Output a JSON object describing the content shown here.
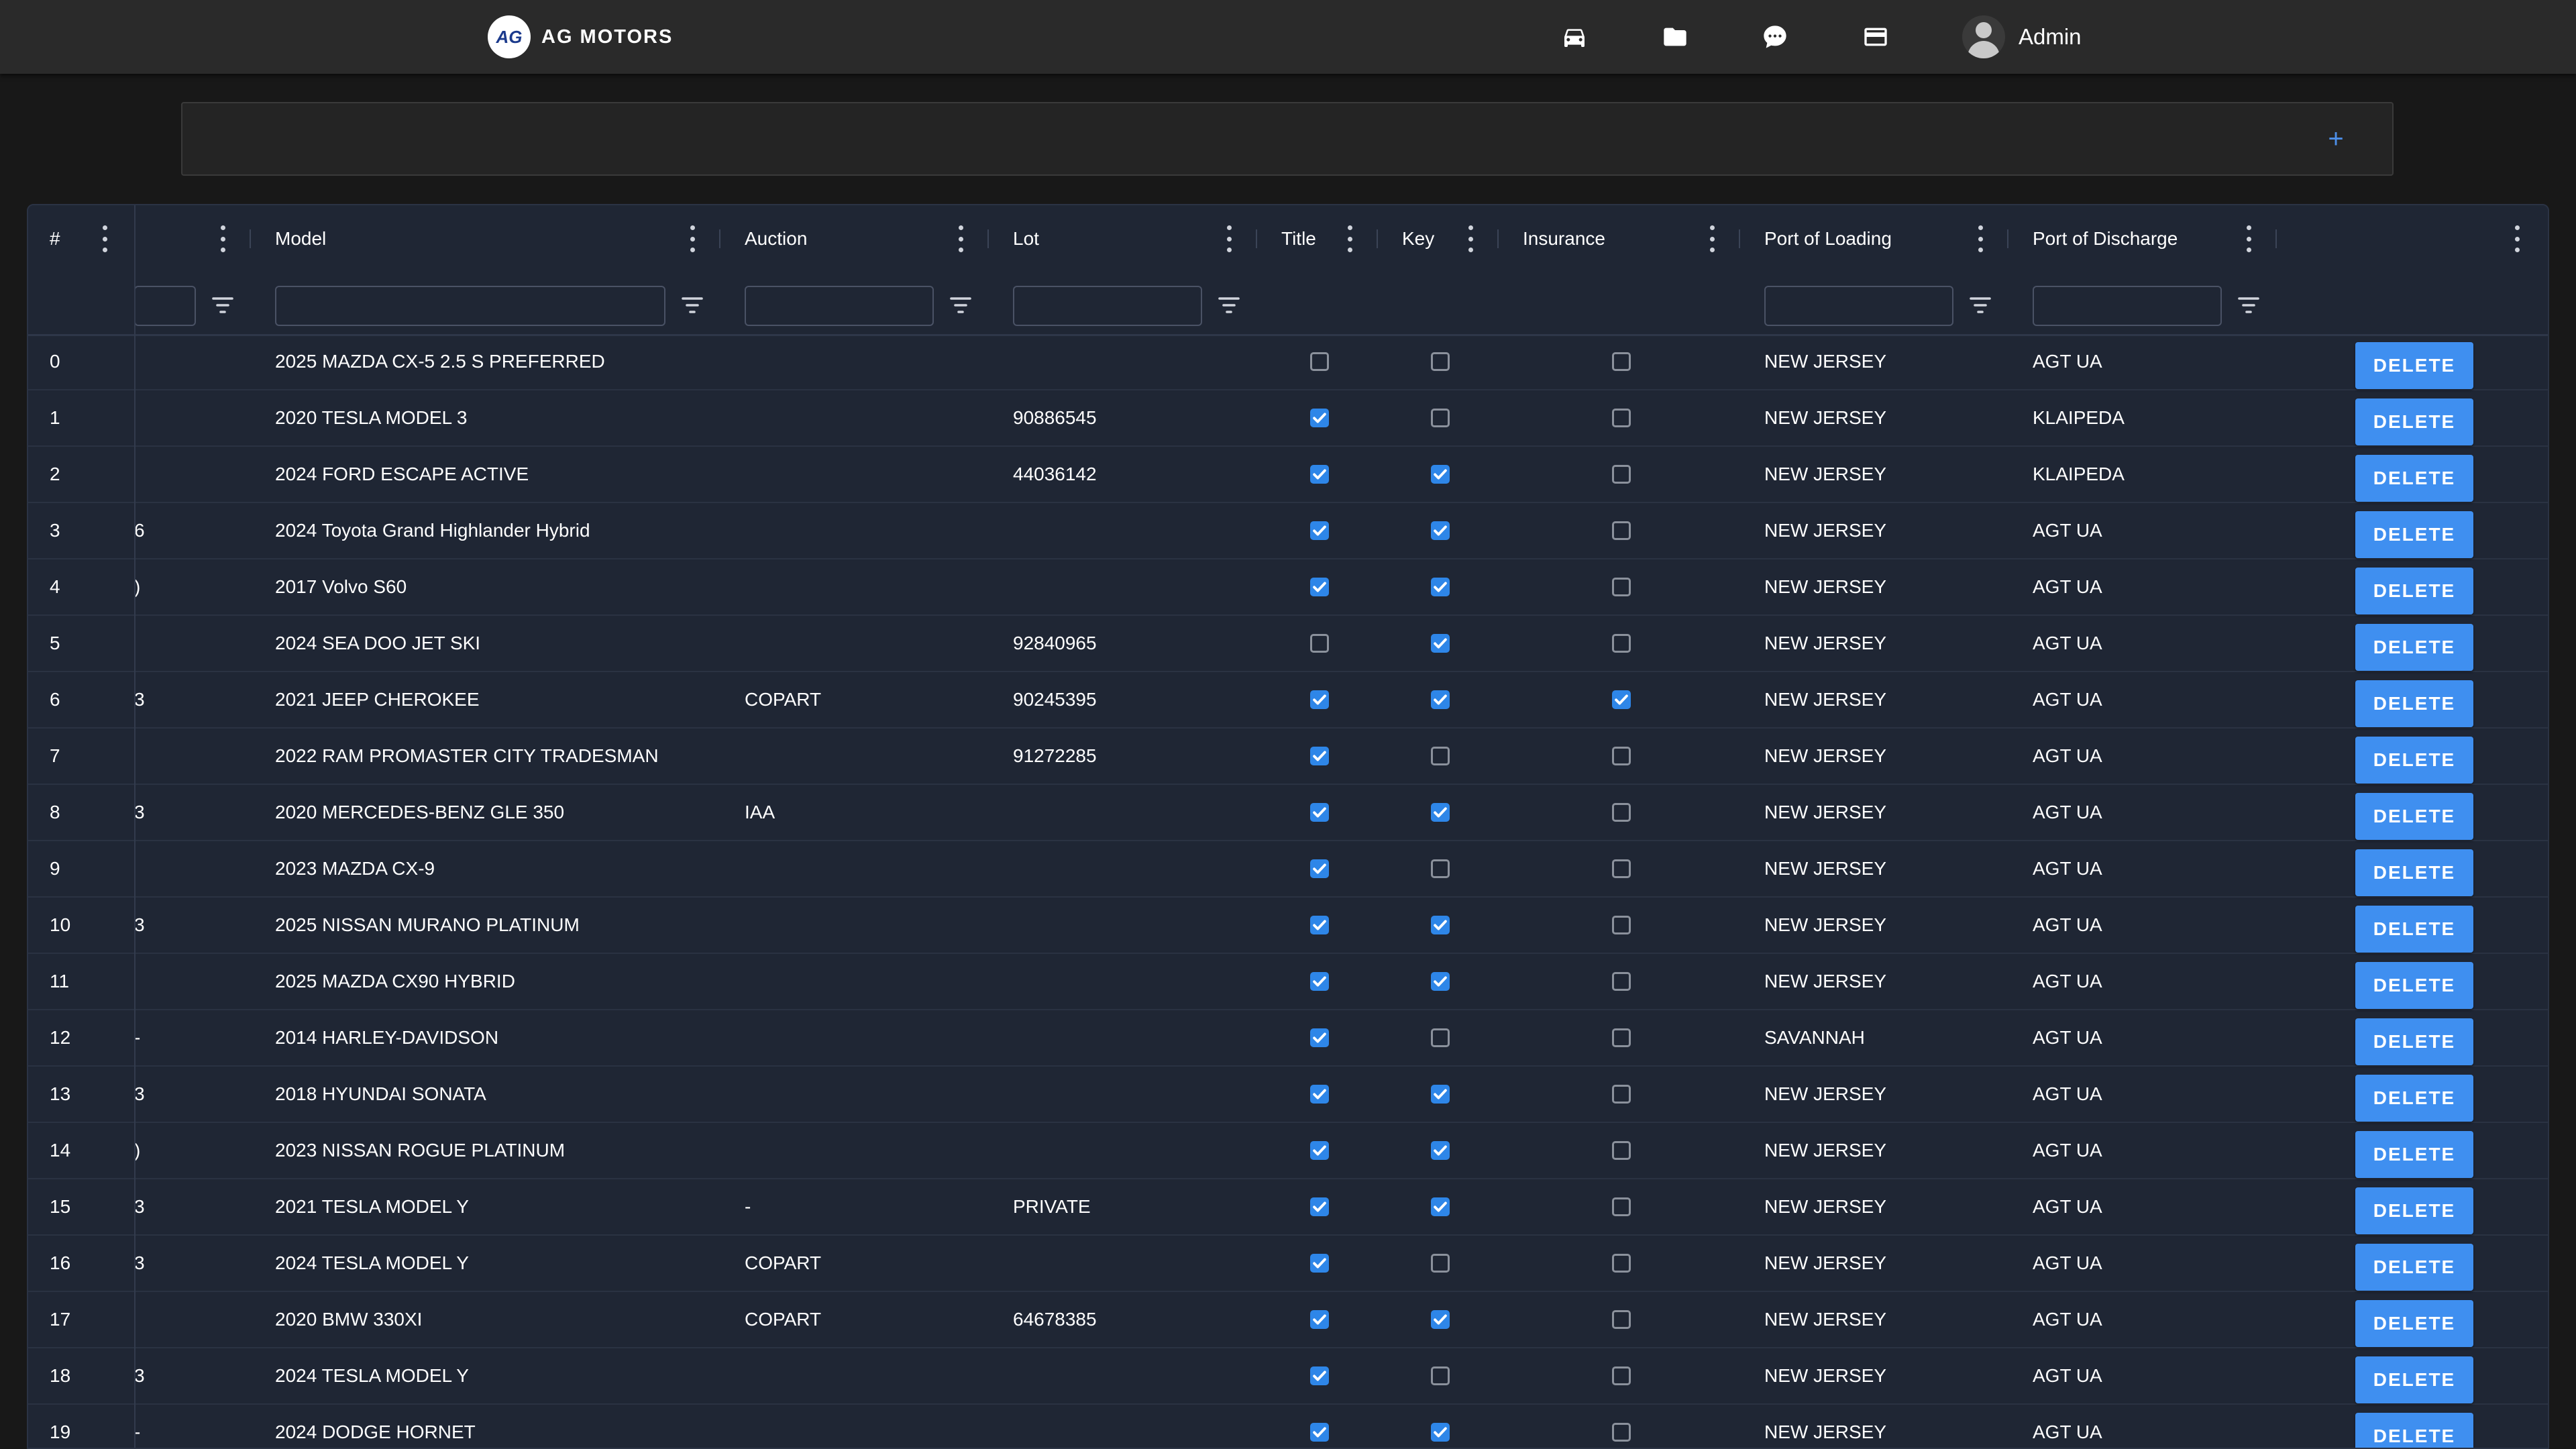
{
  "header": {
    "logo_text": "AG",
    "brand": "AG MOTORS",
    "nav_icons": [
      "car-icon",
      "folder-icon",
      "chat-icon",
      "credit-card-icon"
    ],
    "user_name": "Admin"
  },
  "add_panel": {
    "add_label": "+"
  },
  "table": {
    "columns": [
      "#",
      "",
      "Model",
      "Auction",
      "Lot",
      "Title",
      "Key",
      "Insurance",
      "Port of Loading",
      "Port of Discharge",
      ""
    ],
    "delete_label": "DELETE",
    "rows": [
      {
        "index": "0",
        "vin_tail": "",
        "model": "2025 MAZDA CX-5 2.5 S PREFERRED",
        "auction": "",
        "lot": "",
        "title": false,
        "key": false,
        "insurance": false,
        "port_loading": "NEW JERSEY",
        "port_discharge": "AGT UA"
      },
      {
        "index": "1",
        "vin_tail": "",
        "model": "2020 TESLA MODEL 3",
        "auction": "",
        "lot": "90886545",
        "title": true,
        "key": false,
        "insurance": false,
        "port_loading": "NEW JERSEY",
        "port_discharge": "KLAIPEDA"
      },
      {
        "index": "2",
        "vin_tail": "",
        "model": "2024 FORD ESCAPE ACTIVE",
        "auction": "",
        "lot": "44036142",
        "title": true,
        "key": true,
        "insurance": false,
        "port_loading": "NEW JERSEY",
        "port_discharge": "KLAIPEDA"
      },
      {
        "index": "3",
        "vin_tail": "6",
        "model": "2024 Toyota Grand Highlander Hybrid",
        "auction": "",
        "lot": "",
        "title": true,
        "key": true,
        "insurance": false,
        "port_loading": "NEW JERSEY",
        "port_discharge": "AGT UA"
      },
      {
        "index": "4",
        "vin_tail": ")",
        "model": "2017 Volvo S60",
        "auction": "",
        "lot": "",
        "title": true,
        "key": true,
        "insurance": false,
        "port_loading": "NEW JERSEY",
        "port_discharge": "AGT UA"
      },
      {
        "index": "5",
        "vin_tail": "",
        "model": "2024 SEA DOO JET SKI",
        "auction": "",
        "lot": "92840965",
        "title": false,
        "key": true,
        "insurance": false,
        "port_loading": "NEW JERSEY",
        "port_discharge": "AGT UA"
      },
      {
        "index": "6",
        "vin_tail": "3",
        "model": "2021 JEEP CHEROKEE",
        "auction": "COPART",
        "lot": "90245395",
        "title": true,
        "key": true,
        "insurance": true,
        "port_loading": "NEW JERSEY",
        "port_discharge": "AGT UA"
      },
      {
        "index": "7",
        "vin_tail": "",
        "model": "2022 RAM PROMASTER CITY TRADESMAN",
        "auction": "",
        "lot": "91272285",
        "title": true,
        "key": false,
        "insurance": false,
        "port_loading": "NEW JERSEY",
        "port_discharge": "AGT UA"
      },
      {
        "index": "8",
        "vin_tail": "3",
        "model": "2020 MERCEDES-BENZ GLE 350",
        "auction": "IAA",
        "lot": "",
        "title": true,
        "key": true,
        "insurance": false,
        "port_loading": "NEW JERSEY",
        "port_discharge": "AGT UA"
      },
      {
        "index": "9",
        "vin_tail": "",
        "model": "2023 MAZDA CX-9",
        "auction": "",
        "lot": "",
        "title": true,
        "key": false,
        "insurance": false,
        "port_loading": "NEW JERSEY",
        "port_discharge": "AGT UA"
      },
      {
        "index": "10",
        "vin_tail": "3",
        "model": "2025 NISSAN MURANO PLATINUM",
        "auction": "",
        "lot": "",
        "title": true,
        "key": true,
        "insurance": false,
        "port_loading": "NEW JERSEY",
        "port_discharge": "AGT UA"
      },
      {
        "index": "11",
        "vin_tail": "",
        "model": "2025 MAZDA CX90 HYBRID",
        "auction": "",
        "lot": "",
        "title": true,
        "key": true,
        "insurance": false,
        "port_loading": "NEW JERSEY",
        "port_discharge": "AGT UA"
      },
      {
        "index": "12",
        "vin_tail": "-",
        "model": "2014 HARLEY-DAVIDSON",
        "auction": "",
        "lot": "",
        "title": true,
        "key": false,
        "insurance": false,
        "port_loading": "SAVANNAH",
        "port_discharge": "AGT UA"
      },
      {
        "index": "13",
        "vin_tail": "3",
        "model": "2018 HYUNDAI SONATA",
        "auction": "",
        "lot": "",
        "title": true,
        "key": true,
        "insurance": false,
        "port_loading": "NEW JERSEY",
        "port_discharge": "AGT UA"
      },
      {
        "index": "14",
        "vin_tail": ")",
        "model": "2023 NISSAN ROGUE PLATINUM",
        "auction": "",
        "lot": "",
        "title": true,
        "key": true,
        "insurance": false,
        "port_loading": "NEW JERSEY",
        "port_discharge": "AGT UA"
      },
      {
        "index": "15",
        "vin_tail": "3",
        "model": "2021 TESLA MODEL Y",
        "auction": "-",
        "lot": "PRIVATE",
        "title": true,
        "key": true,
        "insurance": false,
        "port_loading": "NEW JERSEY",
        "port_discharge": "AGT UA"
      },
      {
        "index": "16",
        "vin_tail": "3",
        "model": "2024 TESLA MODEL Y",
        "auction": "COPART",
        "lot": "",
        "title": true,
        "key": false,
        "insurance": false,
        "port_loading": "NEW JERSEY",
        "port_discharge": "AGT UA"
      },
      {
        "index": "17",
        "vin_tail": "",
        "model": "2020 BMW 330XI",
        "auction": "COPART",
        "lot": "64678385",
        "title": true,
        "key": true,
        "insurance": false,
        "port_loading": "NEW JERSEY",
        "port_discharge": "AGT UA"
      },
      {
        "index": "18",
        "vin_tail": "3",
        "model": "2024 TESLA MODEL Y",
        "auction": "",
        "lot": "",
        "title": true,
        "key": false,
        "insurance": false,
        "port_loading": "NEW JERSEY",
        "port_discharge": "AGT UA"
      },
      {
        "index": "19",
        "vin_tail": "-",
        "model": "2024 DODGE HORNET",
        "auction": "",
        "lot": "",
        "title": true,
        "key": true,
        "insurance": false,
        "port_loading": "NEW JERSEY",
        "port_discharge": "AGT UA"
      }
    ]
  },
  "colors": {
    "accent": "#3f8ff0",
    "checkbox_on": "#2e86e8",
    "grid_bg": "#1f2634",
    "topbar_bg": "#2a2a2a"
  }
}
